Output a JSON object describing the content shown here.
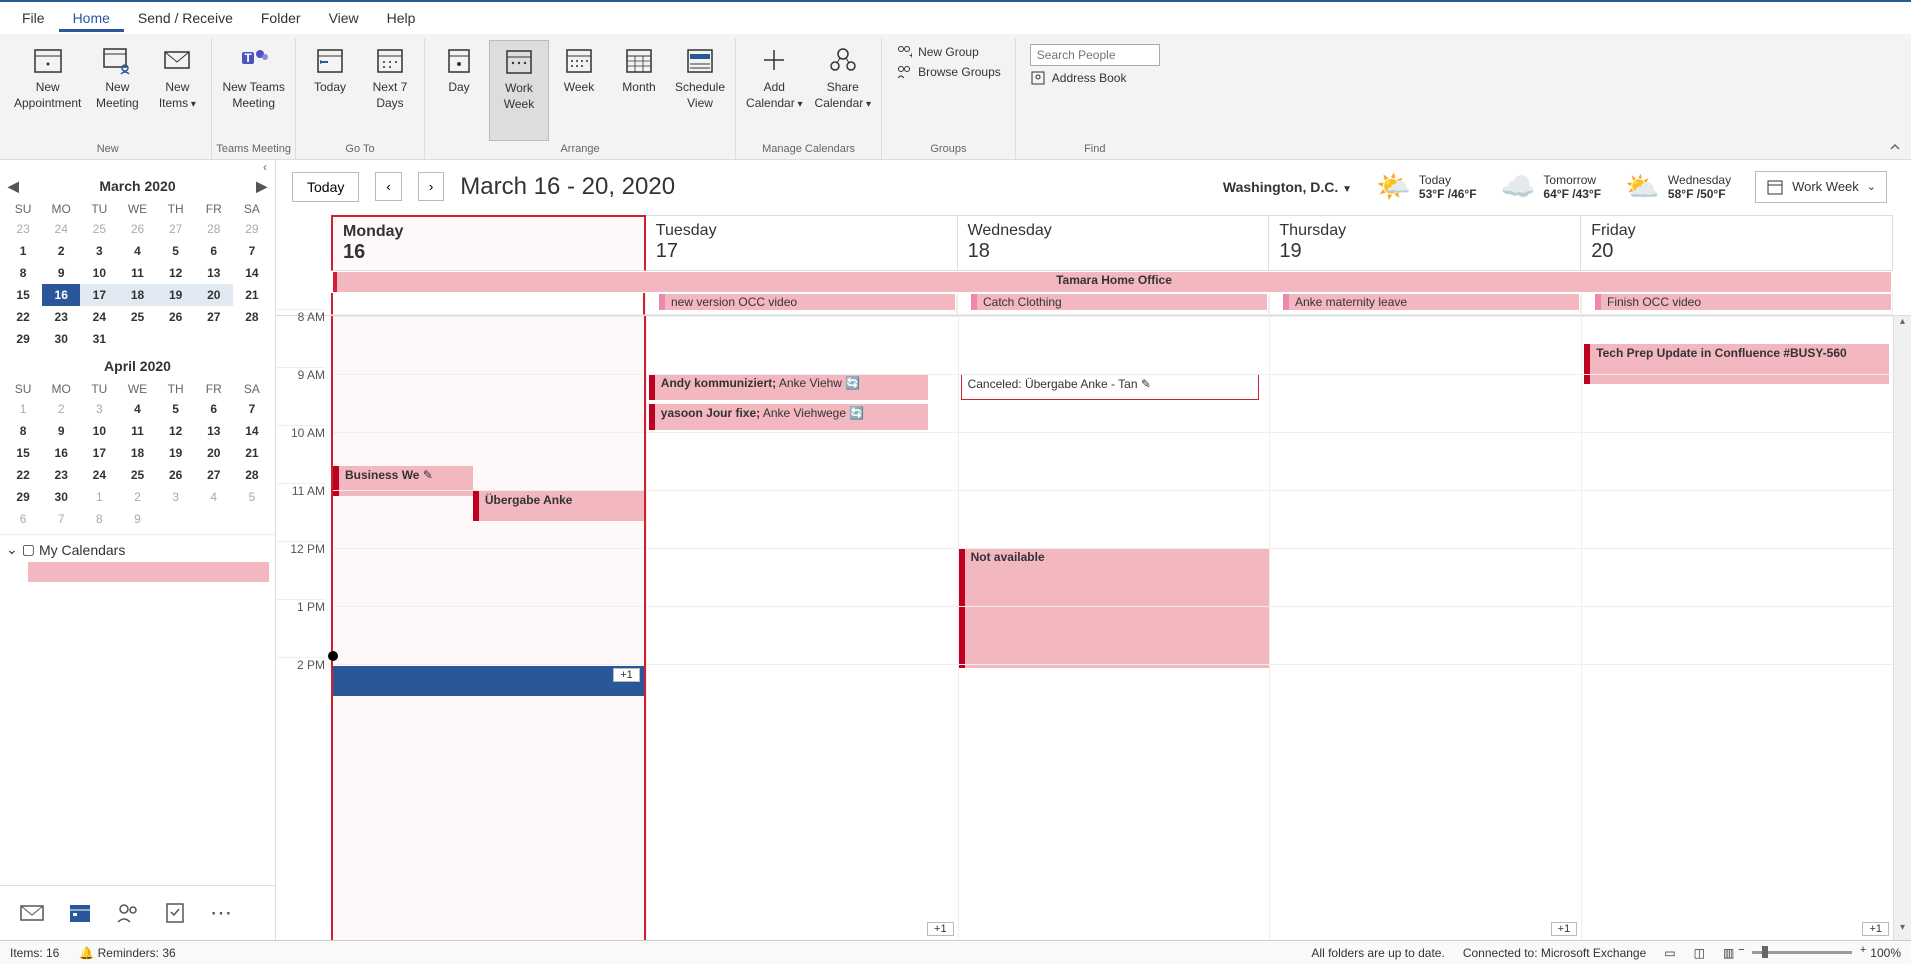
{
  "menu": {
    "file": "File",
    "home": "Home",
    "sendreceive": "Send / Receive",
    "folder": "Folder",
    "view": "View",
    "help": "Help"
  },
  "ribbon": {
    "new": {
      "appointment": "New\nAppointment",
      "meeting": "New\nMeeting",
      "items": "New\nItems",
      "group": "New"
    },
    "teams": {
      "btn": "New Teams\nMeeting",
      "group": "Teams Meeting"
    },
    "goto": {
      "today": "Today",
      "next7": "Next 7\nDays",
      "group": "Go To"
    },
    "arrange": {
      "day": "Day",
      "workweek": "Work\nWeek",
      "week": "Week",
      "month": "Month",
      "scheduleview": "Schedule\nView",
      "group": "Arrange"
    },
    "manage": {
      "addcal": "Add\nCalendar",
      "sharecal": "Share\nCalendar",
      "group": "Manage Calendars"
    },
    "groups": {
      "newgroup": "New Group",
      "browse": "Browse Groups",
      "group": "Groups"
    },
    "find": {
      "searchPlaceholder": "Search People",
      "addressbook": "Address Book",
      "group": "Find"
    }
  },
  "sidebar": {
    "month1": "March 2020",
    "month2": "April 2020",
    "dayHeaders": [
      "SU",
      "MO",
      "TU",
      "WE",
      "TH",
      "FR",
      "SA"
    ],
    "month1Days": [
      23,
      24,
      25,
      26,
      27,
      28,
      29,
      1,
      2,
      3,
      4,
      5,
      6,
      7,
      8,
      9,
      10,
      11,
      12,
      13,
      14,
      15,
      16,
      17,
      18,
      19,
      20,
      21,
      22,
      23,
      24,
      25,
      26,
      27,
      28,
      29,
      30,
      31
    ],
    "month2Days": [
      1,
      2,
      3,
      4,
      5,
      6,
      7,
      8,
      9,
      10,
      11,
      12,
      13,
      14,
      15,
      16,
      17,
      18,
      19,
      20,
      21,
      22,
      23,
      24,
      25,
      26,
      27,
      28,
      29,
      30,
      1,
      2,
      3,
      4,
      5,
      6,
      7,
      8,
      9
    ],
    "myCalendars": "My Calendars"
  },
  "mainHeader": {
    "today": "Today",
    "title": "March 16 - 20, 2020",
    "location": "Washington,  D.C.",
    "weather1": {
      "label": "Today",
      "temp": "53°F /46°F"
    },
    "weather2": {
      "label": "Tomorrow",
      "temp": "64°F /43°F"
    },
    "weather3": {
      "label": "Wednesday",
      "temp": "58°F /50°F"
    },
    "viewSelector": "Work Week"
  },
  "dayHeaders": [
    {
      "name": "Monday",
      "num": "16"
    },
    {
      "name": "Tuesday",
      "num": "17"
    },
    {
      "name": "Wednesday",
      "num": "18"
    },
    {
      "name": "Thursday",
      "num": "19"
    },
    {
      "name": "Friday",
      "num": "20"
    }
  ],
  "allday": {
    "tamara": "Tamara Home Office",
    "tue": "new version OCC video",
    "wed": "Catch Clothing",
    "thu": "Anke maternity leave",
    "fri": "Finish OCC video"
  },
  "hours": [
    "8 AM",
    "9 AM",
    "10 AM",
    "11 AM",
    "12 PM",
    "1 PM",
    "2 PM"
  ],
  "events": {
    "business": "Business We",
    "uebergabe": "Übergabe Anke",
    "andy_b": "Andy kommuniziert;",
    "andy_s": " Anke Viehw",
    "yasoon_b": "yasoon Jour fixe;",
    "yasoon_s": " Anke Viehwege",
    "canceled": "Canceled: Übergabe Anke - Tan",
    "notavail": "Not available",
    "techprep": "Tech Prep Update in Confluence #BUSY-560",
    "plus1": "+1"
  },
  "statusbar": {
    "items": "Items: 16",
    "reminders": "Reminders: 36",
    "folders": "All folders are up to date.",
    "connected": "Connected to: Microsoft Exchange",
    "zoom": "100%"
  }
}
